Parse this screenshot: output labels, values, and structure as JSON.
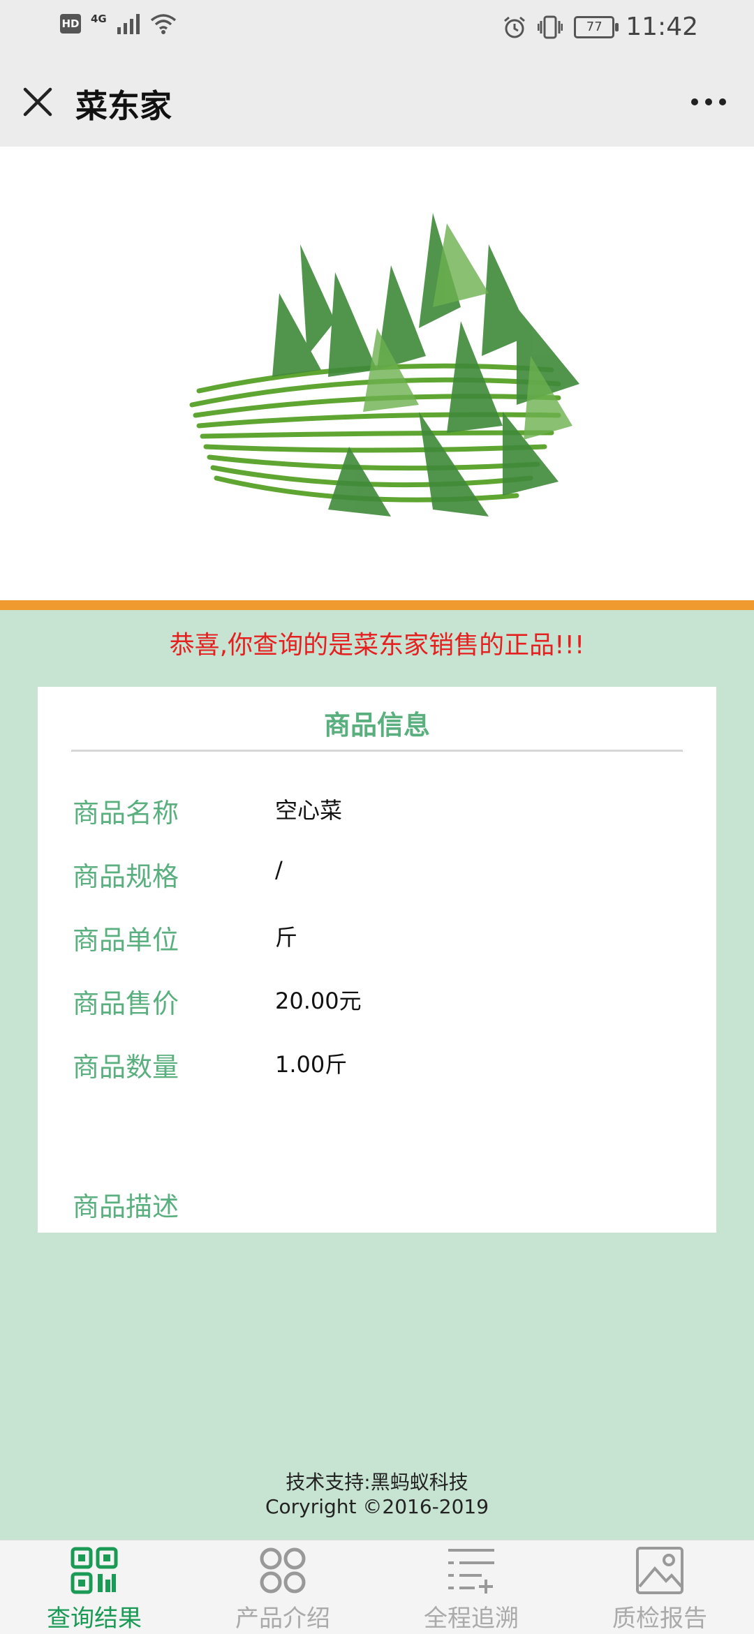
{
  "status": {
    "network": "4G",
    "hd": "HD",
    "battery": "77",
    "time": "11:42"
  },
  "header": {
    "title": "菜东家"
  },
  "product_image": {
    "subject": "water spinach bundle"
  },
  "banner": {
    "text": "恭喜,你查询的是菜东家销售的正品!!!"
  },
  "card": {
    "title": "商品信息",
    "rows": [
      {
        "label": "商品名称",
        "value": "空心菜"
      },
      {
        "label": "商品规格",
        "value": "/"
      },
      {
        "label": "商品单位",
        "value": "斤"
      },
      {
        "label": "商品售价",
        "value": "20.00元"
      },
      {
        "label": "商品数量",
        "value": "1.00斤"
      }
    ],
    "description_label": "商品描述"
  },
  "footer": {
    "support": "技术支持:黑蚂蚁科技",
    "copyright": "Coryright ©2016-2019"
  },
  "tabs": [
    {
      "label": "查询结果",
      "icon": "qr-code-icon",
      "active": true
    },
    {
      "label": "产品介绍",
      "icon": "grid-rings-icon",
      "active": false
    },
    {
      "label": "全程追溯",
      "icon": "list-add-icon",
      "active": false
    },
    {
      "label": "质检报告",
      "icon": "image-icon",
      "active": false
    }
  ],
  "colors": {
    "accent": "#1a9a55",
    "label_green": "#5aaf7e",
    "orange": "#ef9a2e",
    "alert_red": "#e52020",
    "page_bg": "#c7e3d1"
  }
}
